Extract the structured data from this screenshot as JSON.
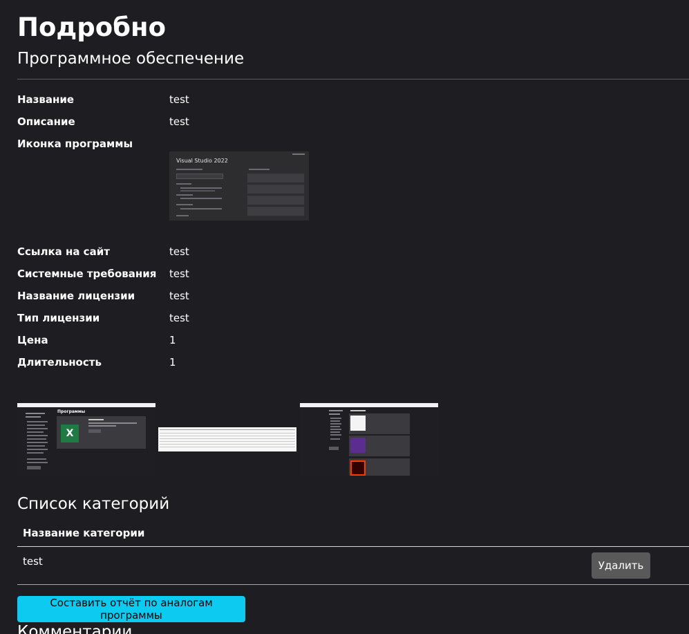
{
  "page": {
    "title": "Подробно",
    "subtitle": "Программное обеспечение"
  },
  "details": [
    {
      "label": "Название",
      "value": "test"
    },
    {
      "label": "Описание",
      "value": "test"
    },
    {
      "label": "Иконка программы",
      "value": ""
    },
    {
      "label": "Ссылка на сайт",
      "value": "test"
    },
    {
      "label": "Системные требования",
      "value": "test"
    },
    {
      "label": "Название лицензии",
      "value": "test"
    },
    {
      "label": "Тип лицензии",
      "value": "test"
    },
    {
      "label": "Цена",
      "value": "1"
    },
    {
      "label": "Длительность",
      "value": "1"
    }
  ],
  "icon_image": {
    "app_title": "Visual Studio 2022"
  },
  "gallery": {
    "thumb1_heading": "Программы",
    "thumb1_logo": "X"
  },
  "categories": {
    "heading": "Список категорий",
    "column_header": "Название категории",
    "rows": [
      {
        "name": "test",
        "delete_label": "Удалить"
      }
    ]
  },
  "report_button_label": "Составить отчёт по аналогам программы",
  "comments_heading": "Комментарии",
  "colors": {
    "background": "#1e1e22",
    "report_button": "#0dcaf0",
    "delete_button": "#595959"
  }
}
